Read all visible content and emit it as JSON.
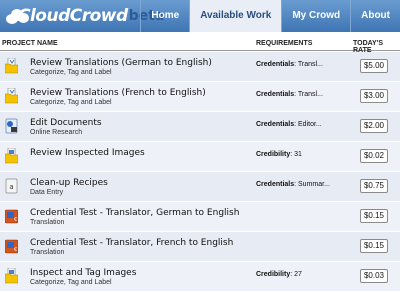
{
  "brand": {
    "name": "CloudCrowd",
    "suffix": "beta"
  },
  "nav": [
    {
      "label": "Home",
      "active": false
    },
    {
      "label": "Available Work",
      "active": true
    },
    {
      "label": "My Crowd",
      "active": false
    },
    {
      "label": "About",
      "active": false
    }
  ],
  "columns": {
    "project": "PROJECT NAME",
    "requirements": "REQUIREMENTS",
    "rate": "TODAY'S RATE"
  },
  "tasks": [
    {
      "icon": "folder-translate-icon",
      "title": "Review Translations (German to English)",
      "category": "Categorize, Tag and Label",
      "req_label": "Credentials",
      "req_value": ": Transl...",
      "rate": "$5.00"
    },
    {
      "icon": "folder-translate-icon",
      "title": "Review Translations (French to English)",
      "category": "Categorize, Tag and Label",
      "req_label": "Credentials",
      "req_value": ": Transl...",
      "rate": "$3.00"
    },
    {
      "icon": "edit-document-icon",
      "title": "Edit Documents",
      "category": "Online Research",
      "req_label": "Credentials",
      "req_value": ": Editor...",
      "rate": "$2.00"
    },
    {
      "icon": "folder-images-icon",
      "title": "Review Inspected Images",
      "category": "",
      "req_label": "Credibility",
      "req_value": ": 31",
      "rate": "$0.02"
    },
    {
      "icon": "recipe-text-icon",
      "title": "Clean-up Recipes",
      "category": "Data Entry",
      "req_label": "Credentials",
      "req_value": ": Summar...",
      "rate": "$0.75"
    },
    {
      "icon": "translation-test-icon",
      "title": "Credential Test - Translator, German to English",
      "category": "Translation",
      "req_label": "",
      "req_value": "",
      "rate": "$0.15"
    },
    {
      "icon": "translation-test-icon",
      "title": "Credential Test - Translator, French to English",
      "category": "Translation",
      "req_label": "",
      "req_value": "",
      "rate": "$0.15"
    },
    {
      "icon": "folder-images-icon",
      "title": "Inspect and Tag Images",
      "category": "Categorize, Tag and Label",
      "req_label": "Credibility",
      "req_value": ": 27",
      "rate": "$0.03"
    }
  ]
}
